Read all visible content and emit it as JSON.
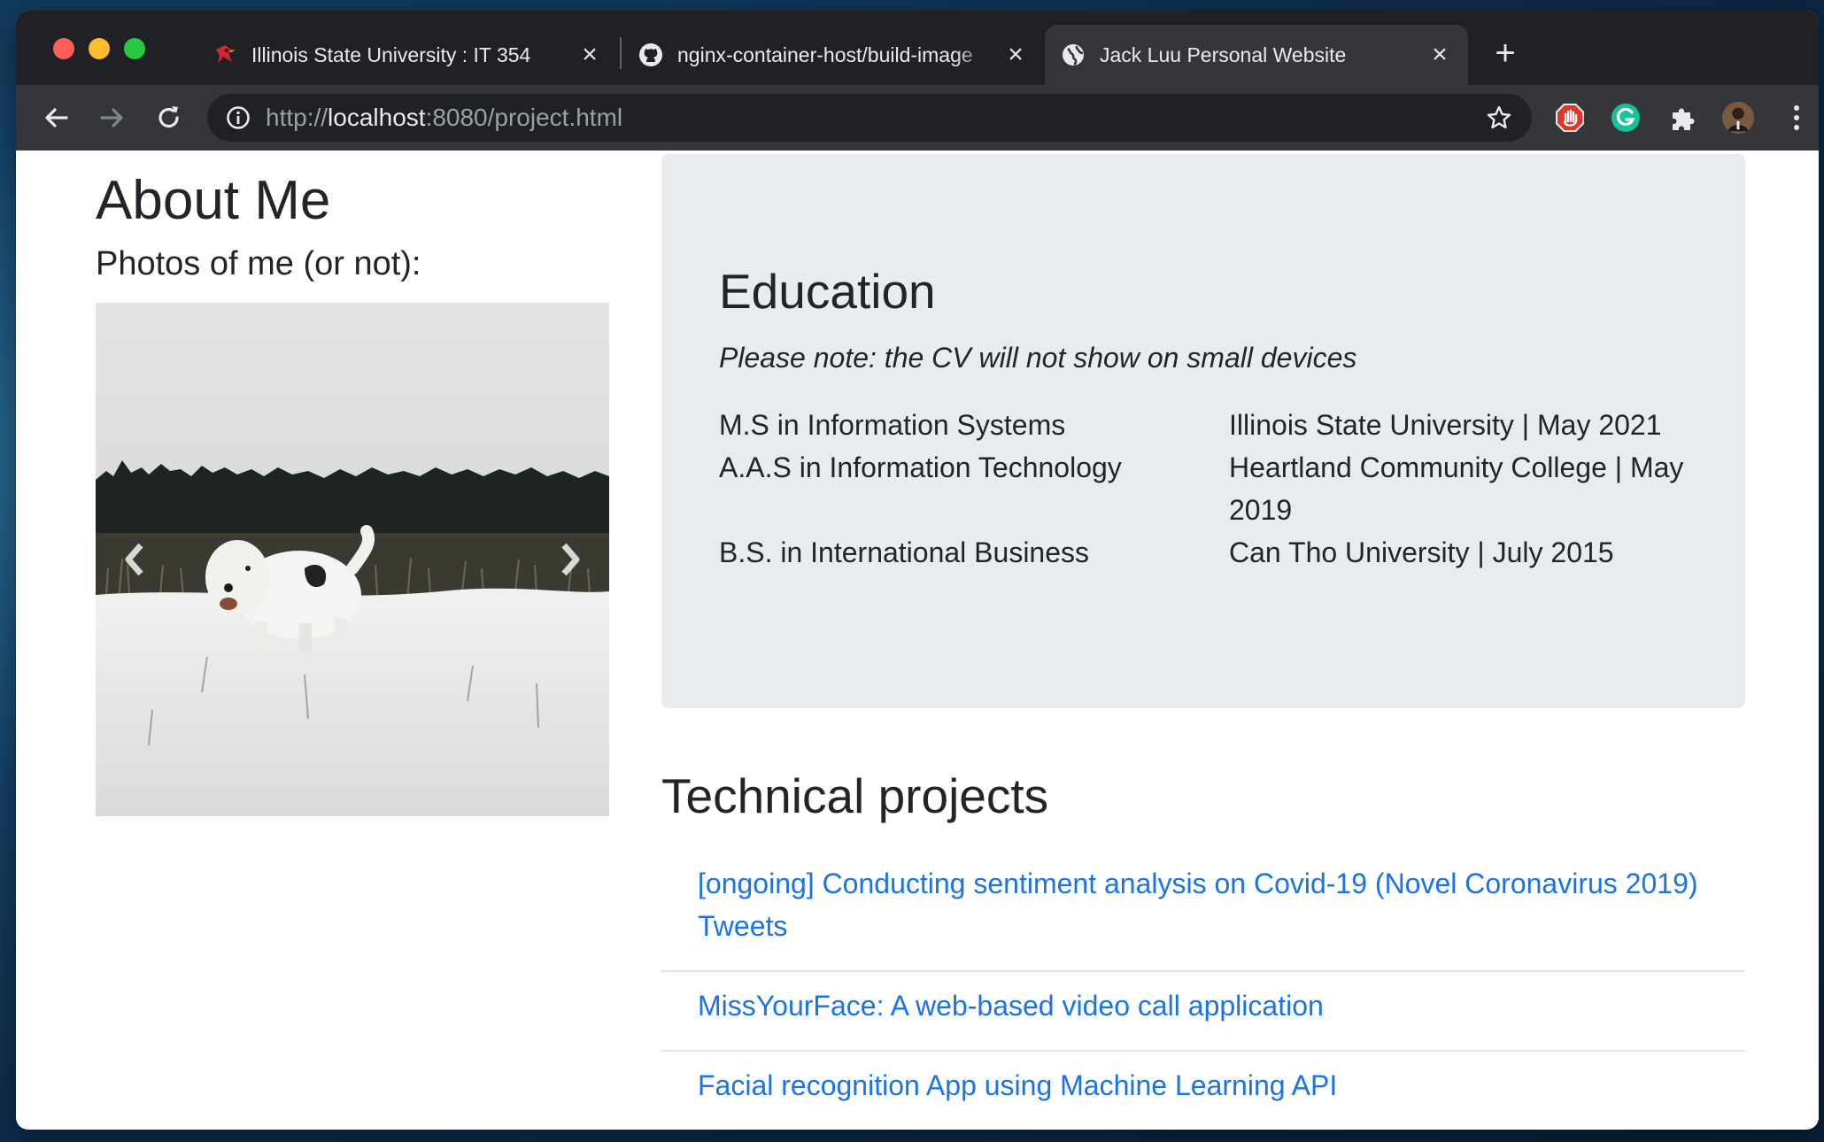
{
  "browser": {
    "tabs": [
      {
        "title": "Illinois State University : IT 354",
        "icon": "redbird-icon"
      },
      {
        "title": "nginx-container-host/build-image",
        "icon": "github-icon"
      },
      {
        "title": "Jack Luu Personal Website",
        "icon": "globe-icon",
        "active": true
      }
    ],
    "address": {
      "scheme": "http://",
      "host": "localhost",
      "rest": ":8080/project.html"
    },
    "extensions": [
      "adblock-icon",
      "grammarly-icon",
      "puzzle-icon",
      "profile-avatar"
    ]
  },
  "page": {
    "about_title": "About Me",
    "photos_title": "Photos of me (or not):",
    "education": {
      "title": "Education",
      "note": "Please note: the CV will not show on small devices",
      "rows": [
        {
          "degree": "M.S in Information Systems",
          "school": "Illinois State University | May 2021"
        },
        {
          "degree": "A.A.S in Information Technology",
          "school": "Heartland Community College | May 2019"
        },
        {
          "degree": "B.S. in International Business",
          "school": "Can Tho University | July 2015"
        }
      ]
    },
    "projects_title": "Technical projects",
    "projects": [
      "[ongoing] Conducting sentiment analysis on Covid-19 (Novel Coronavirus 2019) Tweets",
      "MissYourFace: A web-based video call application",
      "Facial recognition App using Machine Learning API"
    ]
  },
  "colors": {
    "link": "#1a73e8",
    "card": "#e9ecef",
    "tabbar": "#202124",
    "toolbar": "#35363a"
  }
}
